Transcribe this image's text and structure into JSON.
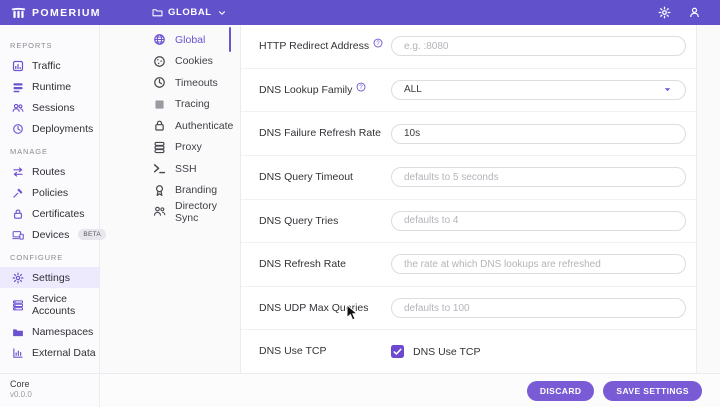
{
  "topbar": {
    "brand": "POMERIUM",
    "context_label": "GLOBAL",
    "icons": [
      "folder-icon",
      "chevron-down-icon",
      "gear-icon",
      "person-icon"
    ]
  },
  "sidebar": {
    "sections": [
      {
        "label": "REPORTS",
        "items": [
          {
            "label": "Traffic",
            "icon": "chart"
          },
          {
            "label": "Runtime",
            "icon": "bars"
          },
          {
            "label": "Sessions",
            "icon": "people"
          },
          {
            "label": "Deployments",
            "icon": "history"
          }
        ]
      },
      {
        "label": "MANAGE",
        "items": [
          {
            "label": "Routes",
            "icon": "routes"
          },
          {
            "label": "Policies",
            "icon": "gavel"
          },
          {
            "label": "Certificates",
            "icon": "lock"
          },
          {
            "label": "Devices",
            "icon": "devices",
            "badge": "BETA"
          }
        ]
      },
      {
        "label": "CONFIGURE",
        "items": [
          {
            "label": "Settings",
            "icon": "gear",
            "active": true
          },
          {
            "label": "Service Accounts",
            "icon": "list"
          },
          {
            "label": "Namespaces",
            "icon": "folder"
          },
          {
            "label": "External Data",
            "icon": "data"
          }
        ]
      }
    ],
    "footer": {
      "product": "Core",
      "version": "v0.0.0"
    }
  },
  "subnav": {
    "items": [
      {
        "label": "Global",
        "icon": "globe",
        "active": true
      },
      {
        "label": "Cookies",
        "icon": "cookie"
      },
      {
        "label": "Timeouts",
        "icon": "clock"
      },
      {
        "label": "Tracing",
        "icon": "square"
      },
      {
        "label": "Authenticate",
        "icon": "lock"
      },
      {
        "label": "Proxy",
        "icon": "stack"
      },
      {
        "label": "SSH",
        "icon": "terminal"
      },
      {
        "label": "Branding",
        "icon": "award"
      },
      {
        "label": "Directory Sync",
        "icon": "directory"
      }
    ]
  },
  "form": {
    "rows": [
      {
        "label": "HTTP Redirect Address",
        "help": true,
        "control": "input",
        "placeholder": "e.g. :8080"
      },
      {
        "label": "DNS Lookup Family",
        "help": true,
        "control": "select",
        "value": "ALL"
      },
      {
        "label": "DNS Failure Refresh Rate",
        "help": false,
        "control": "input",
        "value": "10s"
      },
      {
        "label": "DNS Query Timeout",
        "help": false,
        "control": "input",
        "placeholder": "defaults to 5 seconds"
      },
      {
        "label": "DNS Query Tries",
        "help": false,
        "control": "input",
        "placeholder": "defaults to 4"
      },
      {
        "label": "DNS Refresh Rate",
        "help": false,
        "control": "input",
        "placeholder": "the rate at which DNS lookups are refreshed"
      },
      {
        "label": "DNS UDP Max Queries",
        "help": false,
        "control": "input",
        "placeholder": "defaults to 100"
      },
      {
        "label": "DNS Use TCP",
        "help": false,
        "control": "checkbox",
        "checked": true,
        "checkbox_label": "DNS Use TCP"
      }
    ]
  },
  "footer": {
    "discard_label": "DISCARD",
    "save_label": "SAVE SETTINGS"
  },
  "colors": {
    "topbar": "#6152cc",
    "accent": "#6d52d0",
    "button": "#7a5bd6",
    "active_item_bg": "#eceafc",
    "checkbox": "#6d49d0"
  }
}
